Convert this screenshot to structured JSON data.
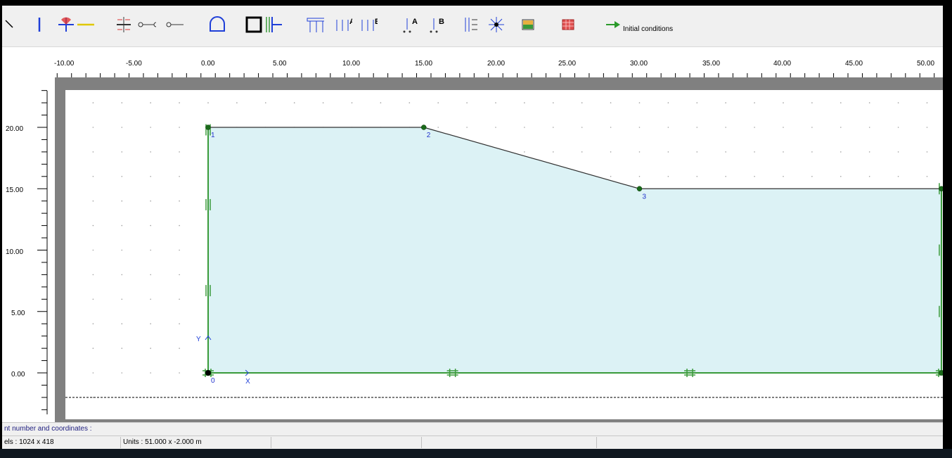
{
  "toolbar": {
    "initial_conditions_label": "Initial conditions"
  },
  "ruler": {
    "x_ticks": [
      "-10.00",
      "-5.00",
      "0.00",
      "5.00",
      "10.00",
      "15.00",
      "20.00",
      "25.00",
      "30.00",
      "35.00",
      "40.00",
      "45.00",
      "50.00"
    ],
    "y_ticks": [
      "20.00",
      "15.00",
      "10.00",
      "5.00",
      "0.00"
    ]
  },
  "geometry": {
    "points": [
      {
        "id": "0",
        "x": 0,
        "y": 0
      },
      {
        "id": "1",
        "x": 0,
        "y": 20
      },
      {
        "id": "2",
        "x": 15,
        "y": 20
      },
      {
        "id": "3",
        "x": 30,
        "y": 15
      },
      {
        "id": "4",
        "x": 51,
        "y": 15
      },
      {
        "id": "5",
        "x": 51,
        "y": 0
      }
    ],
    "axis_x_label": "X",
    "axis_y_label": "Y",
    "fill_color": "#dcf2f5",
    "boundary_color": "#3a9a3a",
    "line_color": "#303030",
    "point_label_color": "#2233cc"
  },
  "status": {
    "hint": "nt number and coordinates :",
    "pixels": "els : 1024 x 418",
    "units": "Units : 51.000 x -2.000 m"
  }
}
